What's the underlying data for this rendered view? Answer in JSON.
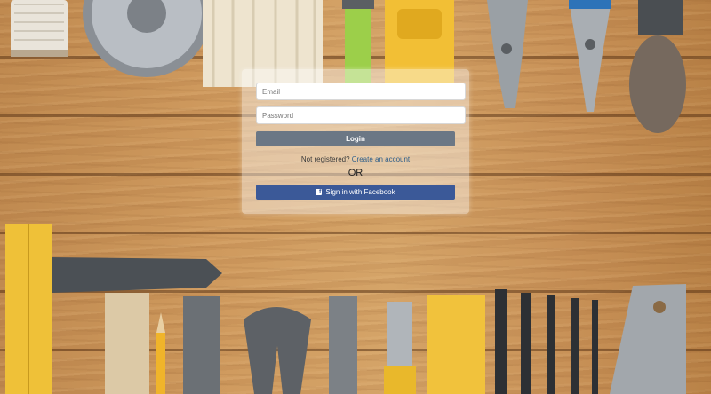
{
  "login_form": {
    "email_placeholder": "Email",
    "password_placeholder": "Password",
    "login_label": "Login",
    "register_prompt": "Not registered?",
    "register_link": "Create an account",
    "or_label": "OR",
    "facebook_label": "Sign in with Facebook",
    "facebook_icon": "facebook-icon"
  },
  "colors": {
    "login_button": "#6b7785",
    "facebook_button": "#3b5998",
    "link": "#2f5f8a"
  }
}
